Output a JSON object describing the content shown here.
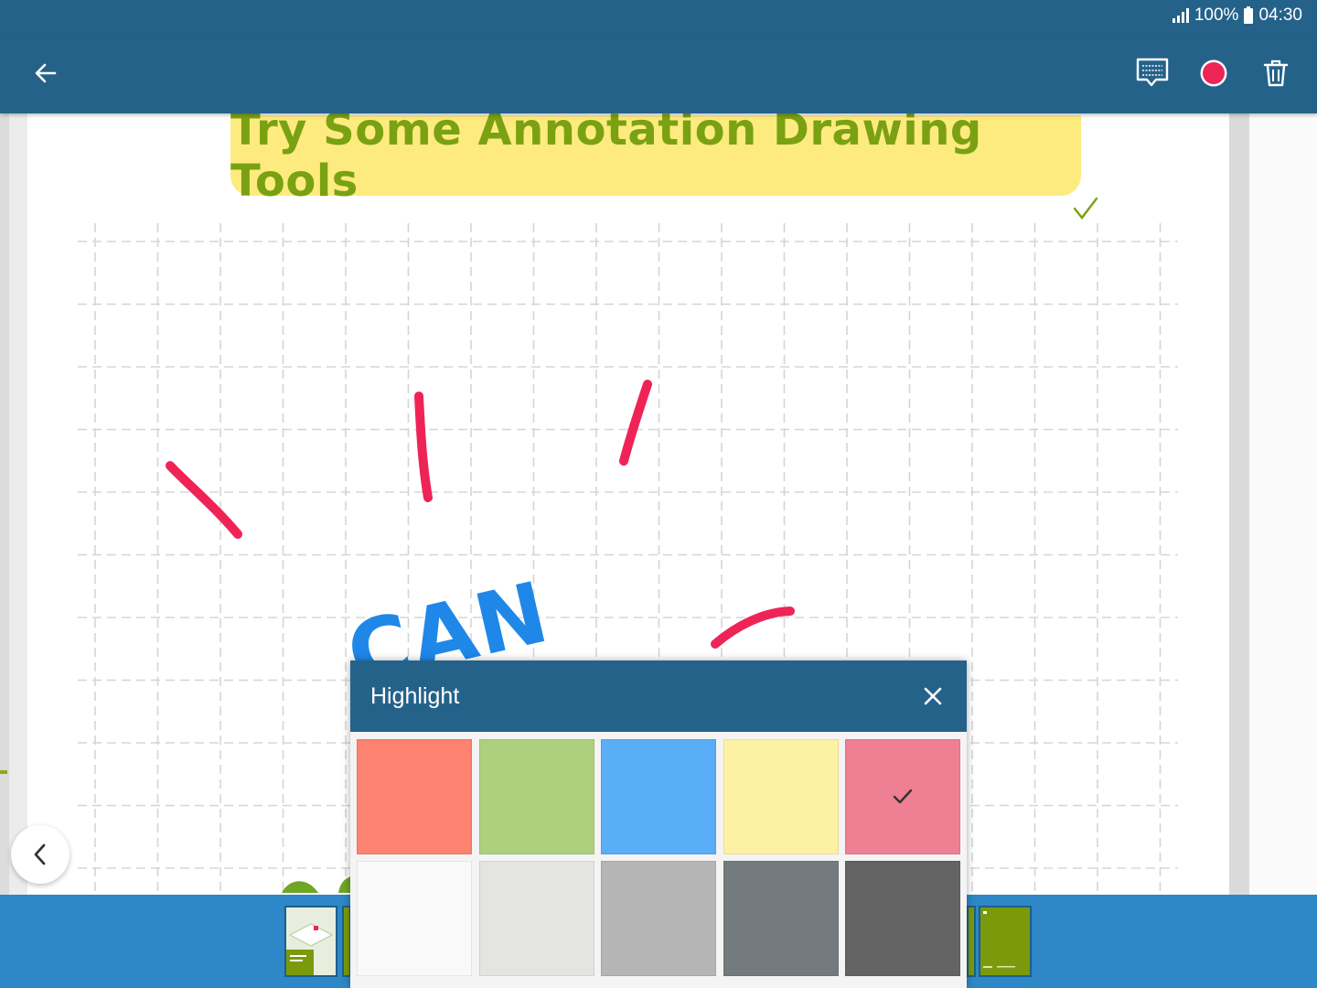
{
  "status_bar": {
    "battery": "100%",
    "time": "04:30"
  },
  "app_bar": {
    "icons": [
      "back-arrow-icon",
      "comment-icon",
      "pen-color-icon",
      "trash-icon"
    ],
    "pen_color": "#ef2456",
    "background": "#25628a"
  },
  "page": {
    "title": "Try Some Annotation Drawing Tools",
    "title_color": "#7aa112",
    "banner_color": "#fdeb7f",
    "handwriting": "CAN",
    "handwriting_color": "#1f87e8",
    "ink_color": "#ef2456"
  },
  "highlight_panel": {
    "title": "Highlight",
    "selected_index": 4,
    "colors": [
      "#fd826f",
      "#aecf7c",
      "#5aadf7",
      "#fdf1a3",
      "#ef7f92",
      "#f9f9f9",
      "#e4e4e2",
      "#b5b5b5",
      "#747b7e",
      "#636363"
    ]
  },
  "thumbnails": {
    "color": "#7a9a0c",
    "bar_color": "#2e87c6"
  }
}
